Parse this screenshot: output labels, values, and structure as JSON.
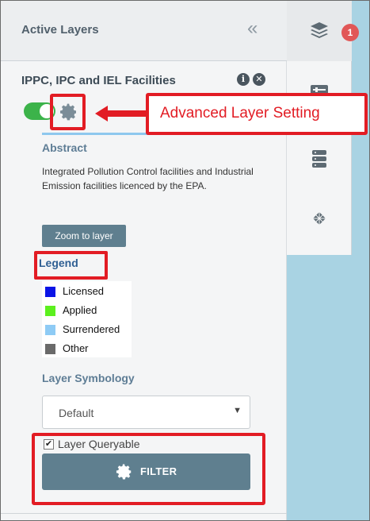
{
  "panel": {
    "title": "Active Layers",
    "collapse_glyph": "«"
  },
  "layer": {
    "title": "IPPC, IPC and IEL Facilities",
    "toggle_on": true,
    "abstract_heading": "Abstract",
    "abstract_text": "Integrated Pollution Control facilities and Industrial Emission facilities licenced by the EPA.",
    "zoom_label": "Zoom to layer",
    "legend_heading": "Legend",
    "legend": [
      {
        "label": "Licensed",
        "color": "#0a14e6"
      },
      {
        "label": "Applied",
        "color": "#5cf01e"
      },
      {
        "label": "Surrendered",
        "color": "#8ecbf5"
      },
      {
        "label": "Other",
        "color": "#6a6a6a"
      }
    ],
    "symbology_heading": "Layer Symbology",
    "symbology_value": "Default",
    "queryable_label": "Layer Queryable",
    "queryable_checked": true,
    "filter_label": "FILTER"
  },
  "toolbar": {
    "layers_badge": "1",
    "icons": [
      "layers-icon",
      "legend-icon",
      "database-icon",
      "basemap-icon"
    ]
  },
  "annotation": {
    "callout_text": "Advanced Layer Setting"
  },
  "colors": {
    "accent_red": "#e21c24",
    "button": "#5f7f8f",
    "toggle": "#3cb34a",
    "map_bg": "#a9d3e3"
  }
}
